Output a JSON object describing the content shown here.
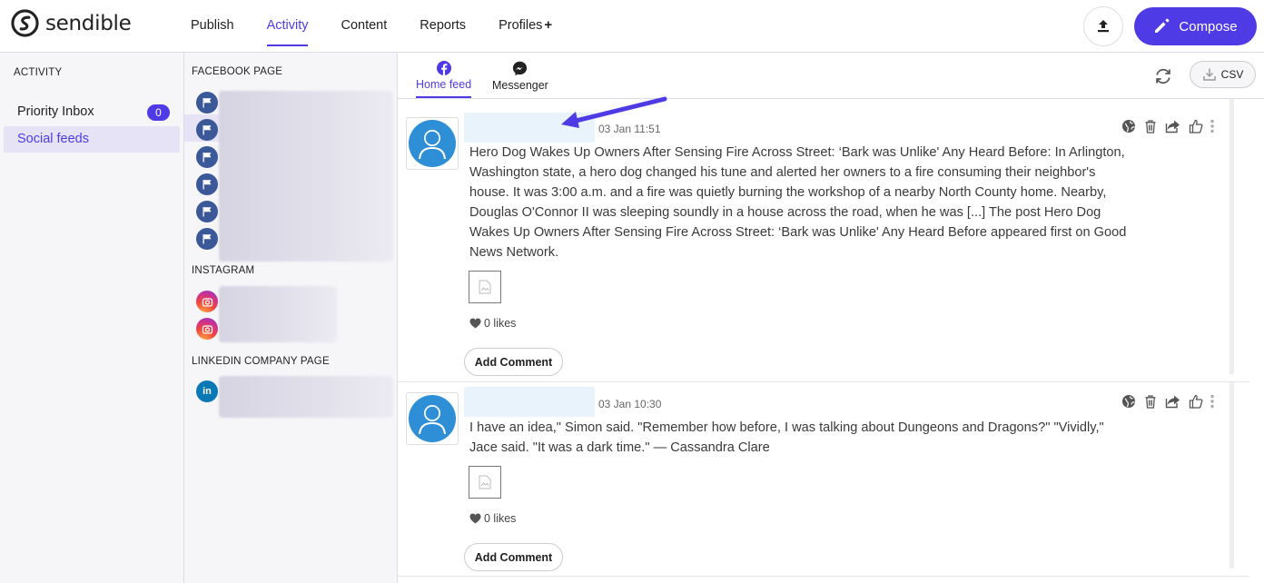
{
  "brand": {
    "name": "sendible",
    "accent": "#4f3be6"
  },
  "nav": {
    "items": [
      {
        "label": "Publish"
      },
      {
        "label": "Activity",
        "active": true
      },
      {
        "label": "Content"
      },
      {
        "label": "Reports"
      },
      {
        "label": "Profiles",
        "suffix": "+"
      }
    ],
    "compose_label": "Compose"
  },
  "activity": {
    "heading": "ACTIVITY",
    "items": [
      {
        "label": "Priority Inbox",
        "count": "0"
      },
      {
        "label": "Social feeds",
        "selected": true
      }
    ]
  },
  "profiles": {
    "groups": [
      {
        "heading": "FACEBOOK PAGE",
        "icon": "facebook-flag-icon",
        "count": 6
      },
      {
        "heading": "INSTAGRAM",
        "icon": "instagram-icon",
        "count": 2
      },
      {
        "heading": "LINKEDIN COMPANY PAGE",
        "icon": "linkedin-icon",
        "count": 1,
        "icon_text": "in"
      }
    ]
  },
  "feed": {
    "tabs": [
      {
        "label": "Home feed",
        "icon": "facebook-icon",
        "active": true
      },
      {
        "label": "Messenger",
        "icon": "messenger-icon"
      }
    ],
    "csv_label": "CSV",
    "posts": [
      {
        "timestamp": "03 Jan 11:51",
        "text": "Hero Dog Wakes Up Owners After Sensing Fire Across Street: ‘Bark was Unlike' Any Heard Before: In Arlington, Washington state, a hero dog changed his tune and alerted her owners to a fire consuming their neighbor's house. It was 3:00 a.m. and a fire was quietly burning the workshop of a nearby North County home. Nearby, Douglas O'Connor II was sleeping soundly in a house across the road, when he was [...] The post Hero Dog Wakes Up Owners After Sensing Fire Across Street: ‘Bark was Unlike' Any Heard Before appeared first on Good News Network.",
        "likes": "0 likes",
        "comment_label": "Add Comment"
      },
      {
        "timestamp": "03 Jan 10:30",
        "text": "I have an idea,\" Simon said. \"Remember how before, I was talking about Dungeons and Dragons?\" \"Vividly,\" Jace said. \"It was a dark time.\" — Cassandra Clare",
        "likes": "0 likes",
        "comment_label": "Add Comment"
      }
    ]
  }
}
